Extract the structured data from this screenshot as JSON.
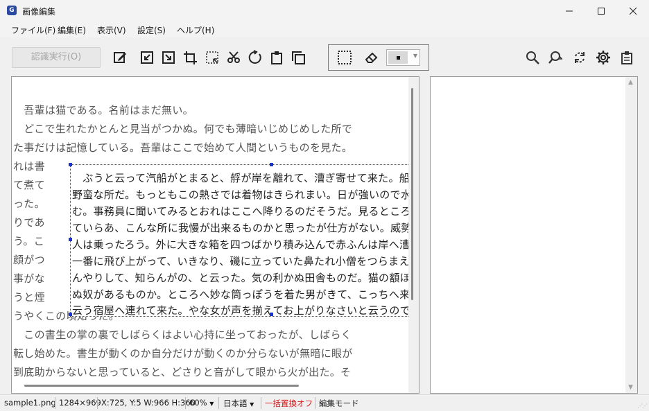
{
  "window": {
    "title": "画像編集",
    "app_icon": "G"
  },
  "menu": [
    "ファイル(F)",
    "編集(E)",
    "表示(V)",
    "設定(S)",
    "ヘルプ(H)"
  ],
  "toolbar": {
    "run_label": "認識実行(O)",
    "icons": [
      "edit-pen-icon",
      "import-left-icon",
      "export-right-icon",
      "crop-frame-icon",
      "select-area-icon",
      "cut-icon",
      "rotate-icon",
      "clipboard-icon",
      "copy-icon"
    ],
    "group_icons": [
      "dotted-rect-select-icon",
      "eraser-icon"
    ],
    "right_icons": [
      "zoom-icon",
      "search-replace-icon",
      "refresh-icon",
      "settings-gear-icon",
      "clipboard-paste-icon"
    ]
  },
  "document": {
    "lines": [
      "　吾輩は猫である。名前はまだ無い。",
      "　どこで生れたかとんと見当がつかぬ。何でも薄暗いじめじめした所で",
      "た事だけは記憶している。吾輩はここで始めて人間というものを見た。",
      "れは書",
      "て煮て",
      "った。",
      "りであ",
      "う。こ",
      "顔がつ",
      "事がな",
      "うと煙",
      "うやくこの頃知った。",
      "　この書生の掌の裏でしばらくはよい心持に坐っておったが、しばらく",
      "転し始めた。書生が動くのか自分だけが動くのか分らないが無暗に眼が",
      "到底助からないと思っていると、どさりと音がして眼から火が出た。そ"
    ],
    "overlay_lines": [
      "　ぶうと云って汽船がとまると、艀が岸を離れて、漕ぎ寄せて来た。船頭",
      "野蛮な所だ。もっともこの熱さでは着物はきられまい。日が強いので水",
      "む。事務員に聞いてみるとおれはここへ降りるのだそうだ。見るところで",
      "ていらあ、こんな所に我慢が出来るものかと思ったが仕方がない。威勢",
      "人は乗ったろう。外に大きな箱を四つばかり積み込んで赤ふんは岸へ漕",
      "一番に飛び上がって、いきなり、磯に立っていた鼻たれ小僧をつらまえ",
      "んやりして、知らんがの、と云った。気の利かぬ田舎ものだ。猫の額ほ",
      "ぬ奴があるものか。ところへ妙な筒っぽうを着た男がきて、こっちへ来い",
      "云う宿屋へ連れて来た。やな女が声を揃えてお上がりなさいと云うので"
    ]
  },
  "status": {
    "file": "sample1.png",
    "size": "1284×969",
    "coords": "X:725, Y:5 W:966 H:360",
    "zoom": "60%",
    "language": "日本語",
    "replace": "一括置換オフ",
    "mode": "編集モード"
  },
  "colors": {
    "accent": "#1a33d6",
    "status_warning": "#d41616"
  }
}
